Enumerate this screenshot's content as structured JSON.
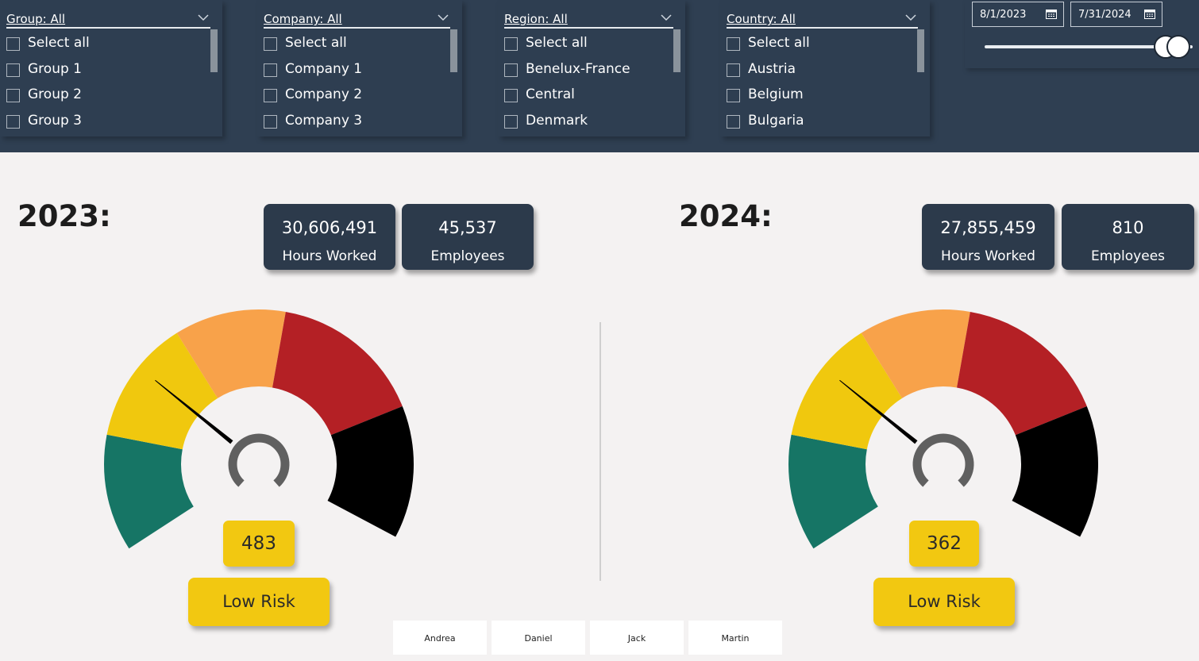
{
  "filters": {
    "group": {
      "title": "Group: All",
      "options": [
        "Select all",
        "Group 1",
        "Group 2",
        "Group 3"
      ]
    },
    "company": {
      "title": "Company: All",
      "options": [
        "Select all",
        "Company 1",
        "Company 2",
        "Company 3"
      ]
    },
    "region": {
      "title": "Region: All",
      "options": [
        "Select all",
        "Benelux-France",
        "Central",
        "Denmark"
      ]
    },
    "country": {
      "title": "Country: All",
      "options": [
        "Select all",
        "Austria",
        "Belgium",
        "Bulgaria"
      ]
    }
  },
  "date_range": {
    "start": "8/1/2023",
    "end": "7/31/2024",
    "start_icon": "calendar-icon",
    "end_icon": "calendar-icon"
  },
  "year_2023": {
    "label": "2023:",
    "hours_value": "30,606,491",
    "hours_label": "Hours Worked",
    "employees_value": "45,537",
    "employees_label": "Employees",
    "gauge_value": "483",
    "risk_label": "Low Risk"
  },
  "year_2024": {
    "label": "2024:",
    "hours_value": "27,855,459",
    "hours_label": "Hours Worked",
    "employees_value": "810",
    "employees_label": "Employees",
    "gauge_value": "362",
    "risk_label": "Low Risk"
  },
  "gauge_colors": {
    "teal": "#167565",
    "yellow": "#f0c80e",
    "orange": "#f8a24a",
    "red": "#b42025",
    "black": "#000000"
  },
  "people": [
    "Andrea",
    "Daniel",
    "Jack",
    "Martin"
  ]
}
